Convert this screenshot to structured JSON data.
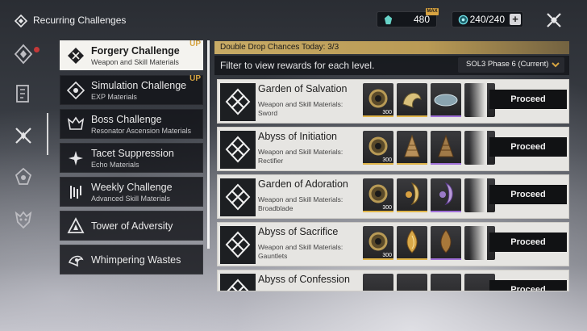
{
  "header": {
    "title": "Recurring Challenges",
    "lunite_value": "480",
    "lunite_max_label": "MAX",
    "stamina_value": "240/240",
    "plus_label": "+"
  },
  "categories": [
    {
      "name": "Forgery Challenge",
      "sub": "Weapon and Skill Materials",
      "up": "UP"
    },
    {
      "name": "Simulation Challenge",
      "sub": "EXP Materials",
      "up": "UP"
    },
    {
      "name": "Boss Challenge",
      "sub": "Resonator Ascension Materials",
      "up": ""
    },
    {
      "name": "Tacet Suppression",
      "sub": "Echo Materials",
      "up": ""
    },
    {
      "name": "Weekly Challenge",
      "sub": "Advanced Skill Materials",
      "up": ""
    },
    {
      "name": "Tower of Adversity",
      "sub": "",
      "up": ""
    },
    {
      "name": "Whimpering Wastes",
      "sub": "",
      "up": ""
    }
  ],
  "panel": {
    "drop_banner": "Double Drop Chances Today: 3/3",
    "filter_text": "Filter to view rewards for each level.",
    "phase_selected": "SOL3 Phase 6 (Current)"
  },
  "levels": [
    {
      "name": "Garden of Salvation",
      "sub": "Weapon and Skill Materials: Sword",
      "count": "300",
      "proceed": "Proceed"
    },
    {
      "name": "Abyss of Initiation",
      "sub": "Weapon and Skill Materials: Rectifier",
      "count": "300",
      "proceed": "Proceed"
    },
    {
      "name": "Garden of Adoration",
      "sub": "Weapon and Skill Materials: Broadblade",
      "count": "300",
      "proceed": "Proceed"
    },
    {
      "name": "Abyss of Sacrifice",
      "sub": "Weapon and Skill Materials: Gauntlets",
      "count": "300",
      "proceed": "Proceed"
    },
    {
      "name": "Abyss of Confession",
      "sub": "",
      "count": "",
      "proceed": "Proceed"
    }
  ],
  "colors": {
    "accent_gold": "#d6a442",
    "rarity_gold": "#e0b54a",
    "rarity_purple": "#a070d8",
    "rarity_blue": "#5a8ee0"
  }
}
